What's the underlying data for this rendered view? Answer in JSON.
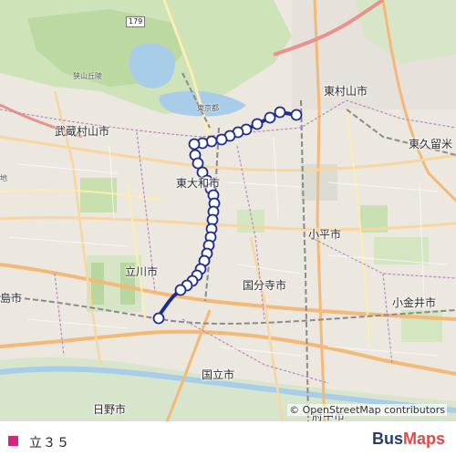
{
  "map": {
    "city_labels": [
      {
        "name": "higashimurayama",
        "text": "東村山市"
      },
      {
        "name": "musashimurayama",
        "text": "武蔵村山市"
      },
      {
        "name": "higashikurume",
        "text": "東久留米"
      },
      {
        "name": "higashiyamato",
        "text": "東大和市"
      },
      {
        "name": "kodaira",
        "text": "小平市"
      },
      {
        "name": "tachikawa",
        "text": "立川市"
      },
      {
        "name": "kokubunji",
        "text": "国分寺市"
      },
      {
        "name": "koganei",
        "text": "小金井市"
      },
      {
        "name": "akishima",
        "text": "島市"
      },
      {
        "name": "kunitachi",
        "text": "国立市"
      },
      {
        "name": "hino",
        "text": "日野市"
      },
      {
        "name": "fuchu",
        "text": "府中市"
      }
    ],
    "small_labels": {
      "sayama_hills": "狭山丘陵",
      "tokyo_to": "東京都",
      "chi": "地"
    },
    "route_shield": "179",
    "attribution": "© OpenStreetMap contributors"
  },
  "route": {
    "color": "#d5257f",
    "line_color": "#1c2d8f"
  },
  "legend": {
    "route_name": "立３５",
    "brand_part1": "Bus",
    "brand_part2": "Maps"
  }
}
